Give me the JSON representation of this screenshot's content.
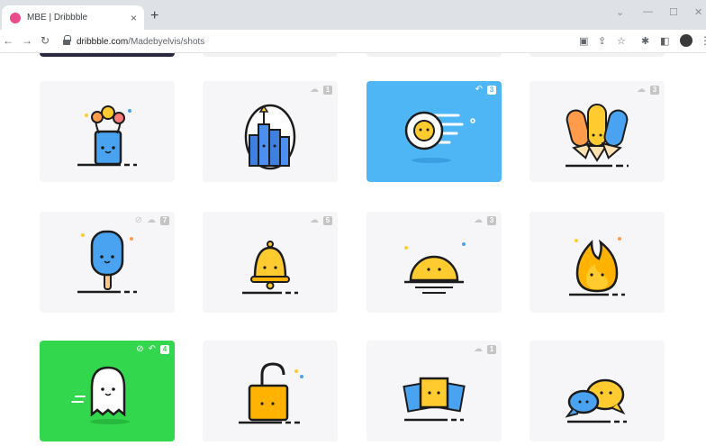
{
  "browser": {
    "tab_title": "MBE | Dribbble",
    "tab_close": "×",
    "new_tab": "+",
    "url_host": "dribbble.com",
    "url_path": "/Madebyelvis/shots",
    "window_controls": [
      "⌄",
      "—",
      "☐",
      "✕"
    ]
  },
  "shots": [
    {
      "subject": "flower-pot",
      "badges": [],
      "bg": "light"
    },
    {
      "subject": "castle",
      "badges": [
        {
          "icon": "rebound-icon",
          "count": "1"
        }
      ],
      "bg": "light"
    },
    {
      "subject": "comet",
      "badges": [
        {
          "icon": "rebound-icon",
          "count": "3"
        }
      ],
      "bg": "blue"
    },
    {
      "subject": "pencils",
      "badges": [
        {
          "icon": "rebound-icon",
          "count": "3"
        }
      ],
      "bg": "light"
    },
    {
      "subject": "popsicle",
      "badges": [
        {
          "icon": "attachment-icon",
          "count": ""
        },
        {
          "icon": "rebound-icon",
          "count": "7"
        }
      ],
      "bg": "light"
    },
    {
      "subject": "bell",
      "badges": [
        {
          "icon": "rebound-icon",
          "count": "5"
        }
      ],
      "bg": "light"
    },
    {
      "subject": "sunset",
      "badges": [
        {
          "icon": "rebound-icon",
          "count": "3"
        }
      ],
      "bg": "light"
    },
    {
      "subject": "flame",
      "badges": [],
      "bg": "light"
    },
    {
      "subject": "ghost",
      "badges": [
        {
          "icon": "attachment-icon",
          "count": ""
        },
        {
          "icon": "rebound-icon",
          "count": "4"
        }
      ],
      "bg": "green"
    },
    {
      "subject": "padlock",
      "badges": [],
      "bg": "light"
    },
    {
      "subject": "photos",
      "badges": [
        {
          "icon": "rebound-icon",
          "count": "1"
        }
      ],
      "bg": "light"
    },
    {
      "subject": "chat-bubbles",
      "badges": [],
      "bg": "light"
    }
  ],
  "colors": {
    "blue_card": "#4fb6f6",
    "green_card": "#33d74d",
    "accent_yellow": "#ffcb2f",
    "outline": "#1c1c1c"
  }
}
